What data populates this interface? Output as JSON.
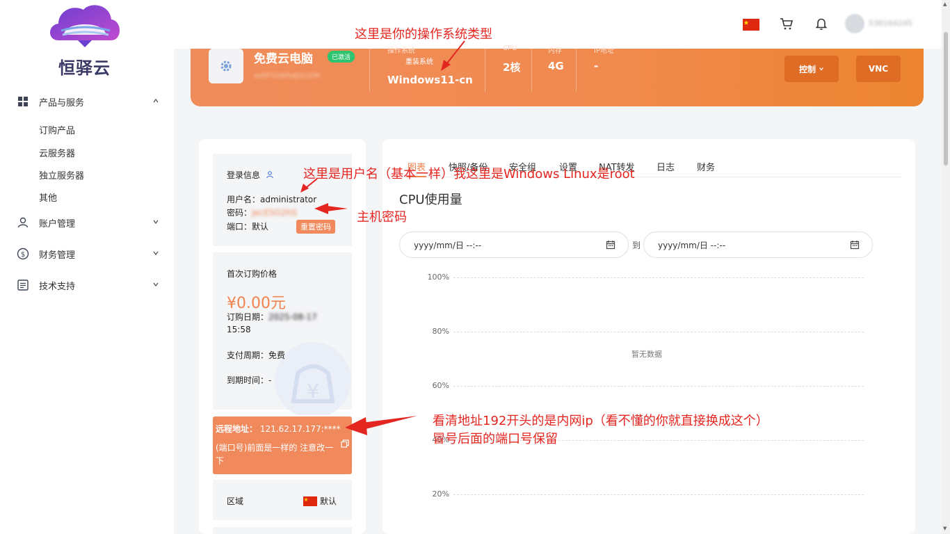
{
  "brand": {
    "name": "恒驿云"
  },
  "sidebar": {
    "items": [
      {
        "label": "产品与服务",
        "icon": "grid-icon",
        "expanded": true
      },
      {
        "label": "账户管理",
        "icon": "user-icon",
        "expanded": false
      },
      {
        "label": "财务管理",
        "icon": "dollar-icon",
        "expanded": false
      },
      {
        "label": "技术支持",
        "icon": "document-icon",
        "expanded": false
      }
    ],
    "subitems": [
      "订购产品",
      "云服务器",
      "独立服务器",
      "其他"
    ]
  },
  "header": {
    "user_id": "536164245",
    "icons": [
      "china-flag-icon",
      "cart-icon",
      "bell-icon"
    ]
  },
  "banner": {
    "title": "免费云电脑",
    "status_badge": "已激活",
    "product_id": "seEFYGW5dJSCIZM",
    "os_label": "操作系统",
    "reinstall_label": "重装系统",
    "os_value": "Windows11-cn",
    "cpu_label": "CPU",
    "cpu_value": "2核",
    "mem_label": "内存",
    "mem_value": "4G",
    "ip_label": "IP地址",
    "ip_value": "-",
    "control_button": "控制",
    "vnc_button": "VNC"
  },
  "login_info": {
    "title": "登录信息",
    "username_label": "用户名：",
    "username_value": "administrator",
    "password_label": "密码：",
    "password_value": "jecE5O2hS",
    "port_label": "端口：",
    "port_value": "默认",
    "reset_button": "重置密码"
  },
  "pricing": {
    "first_price_label": "首次订购价格",
    "price": "¥0.00元",
    "order_date_label": "订购日期：",
    "order_date_value": "2025-08-17",
    "order_time": "15:58",
    "billing_cycle_label": "支付周期：",
    "billing_cycle_value": "免费",
    "expire_label": "到期时间：",
    "expire_value": "-"
  },
  "remote": {
    "label": "远程地址：",
    "value": "121.62.17.177:****",
    "note": "(端口号)前面是一样的 注意改一下"
  },
  "region": {
    "label": "区域",
    "value": "默认"
  },
  "tabs": [
    "图表",
    "快照/备份",
    "安全组",
    "设置",
    "NAT转发",
    "日志",
    "财务"
  ],
  "chart": {
    "title": "CPU使用量",
    "date_start_placeholder": "yyyy/mm/日 --:--",
    "date_separator": "到",
    "date_end_placeholder": "yyyy/mm/日 --:--",
    "no_data": "暂无数据"
  },
  "chart_data": {
    "type": "line",
    "title": "CPU使用量",
    "xlabel": "",
    "ylabel": "",
    "y_ticks": [
      "100%",
      "80%",
      "60%",
      "40%",
      "20%"
    ],
    "ylim": [
      0,
      100
    ],
    "series": [],
    "grid": true
  },
  "annotations": {
    "os_note": "这里是你的操作系统类型",
    "username_note": "这里是用户名（基本一样）我这里是Windows Linux是root",
    "password_note": "主机密码",
    "address_note_1": "看清地址192开头的是内网ip（看不懂的你就直接换成这个）",
    "address_note_2": "冒号后面的端口号保留"
  },
  "colors": {
    "accent": "#f0844f",
    "banner_start": "#ef8c5b",
    "banner_end": "#ed8530",
    "badge_green": "#2ec46f",
    "annotation_red": "#e42620"
  }
}
